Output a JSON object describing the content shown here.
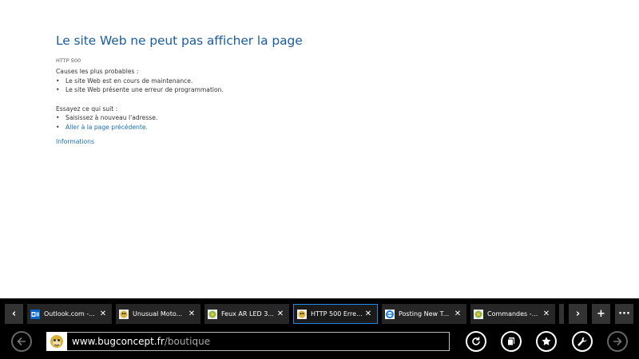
{
  "error": {
    "title": "Le site Web ne peut pas afficher la page",
    "code": "HTTP 500",
    "causes_heading": "Causes les plus probables :",
    "causes": [
      "Le site Web est en cours de maintenance.",
      "Le site Web présente une erreur de programmation."
    ],
    "try_heading": "Essayez ce qui suit :",
    "try_items": [
      "Saisissez à nouveau l'adresse.",
      "Aller à la page précédente."
    ],
    "info_link": "Informations"
  },
  "tabs": [
    {
      "title": "Outlook.com -...",
      "icon": "outlook-icon"
    },
    {
      "title": "Unusual Moto...",
      "icon": "site-favicon"
    },
    {
      "title": "Feux AR LED 3...",
      "icon": "site-favicon"
    },
    {
      "title": "HTTP 500 Erre...",
      "icon": "site-favicon",
      "active": true
    },
    {
      "title": "Posting New T...",
      "icon": "ie-icon"
    },
    {
      "title": "Commandes -...",
      "icon": "site-favicon"
    }
  ],
  "tab_buttons": {
    "prev": "‹",
    "next": "›",
    "new": "+",
    "more": "···",
    "close": "✕"
  },
  "address": {
    "domain": "www.bugconcept.fr",
    "path": "/boutique"
  },
  "colors": {
    "title": "#1a5d9e",
    "link": "#1a6fb5",
    "bar": "#000000",
    "active_tab_border": "#1e86e0"
  }
}
